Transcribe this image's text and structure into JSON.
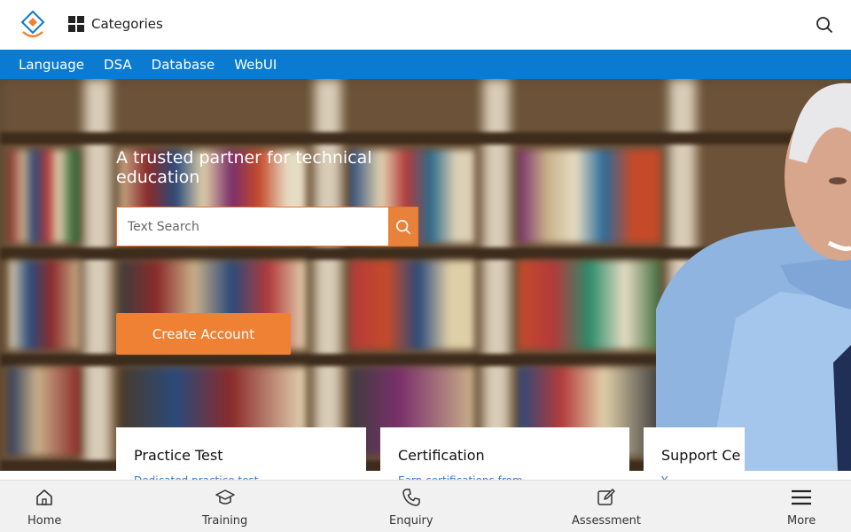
{
  "header": {
    "categories_label": "Categories"
  },
  "nav": {
    "items": [
      "Language",
      "DSA",
      "Database",
      "WebUI"
    ]
  },
  "hero": {
    "title": "A trusted partner for technical education",
    "search_placeholder": "Text Search",
    "create_account_label": "Create Account"
  },
  "cards": [
    {
      "title": "Practice Test",
      "subtitle": "Dedicated practice test"
    },
    {
      "title": "Certification",
      "subtitle": "Earn certifications from"
    },
    {
      "title": "Support Ce",
      "subtitle": "Y"
    }
  ],
  "bottom_nav": {
    "items": [
      {
        "label": "Home",
        "icon": "home-icon"
      },
      {
        "label": "Training",
        "icon": "graduation-cap-icon"
      },
      {
        "label": "Enquiry",
        "icon": "phone-icon"
      },
      {
        "label": "Assessment",
        "icon": "edit-icon"
      },
      {
        "label": "More",
        "icon": "menu-icon"
      }
    ]
  },
  "colors": {
    "nav_blue": "#0a7bd0",
    "accent_orange": "#ef8134",
    "card_link_blue": "#3a78c9"
  }
}
